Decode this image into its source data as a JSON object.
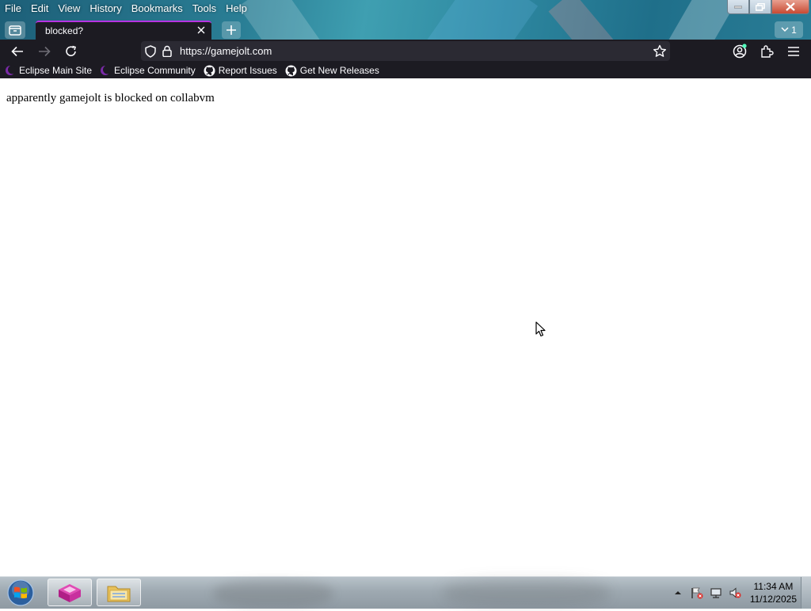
{
  "menubar": {
    "items": [
      "File",
      "Edit",
      "View",
      "History",
      "Bookmarks",
      "Tools",
      "Help"
    ]
  },
  "tabs": {
    "active_title": "blocked?",
    "count": "1"
  },
  "navigation": {
    "url": "https://gamejolt.com"
  },
  "bookmarks": {
    "items": [
      {
        "label": "Eclipse Main Site",
        "icon": "eclipse-icon"
      },
      {
        "label": "Eclipse Community",
        "icon": "eclipse-icon"
      },
      {
        "label": "Report Issues",
        "icon": "github-icon"
      },
      {
        "label": "Get New Releases",
        "icon": "github-icon"
      }
    ]
  },
  "page": {
    "text": "apparently gamejolt is blocked on collabvm"
  },
  "taskbar": {
    "time": "11:34 AM",
    "date": "11/12/2025"
  },
  "colors": {
    "toolbar_bg": "#1c1b22",
    "urlbar_bg": "#2b2a33",
    "tab_accent": "#b833e1"
  }
}
